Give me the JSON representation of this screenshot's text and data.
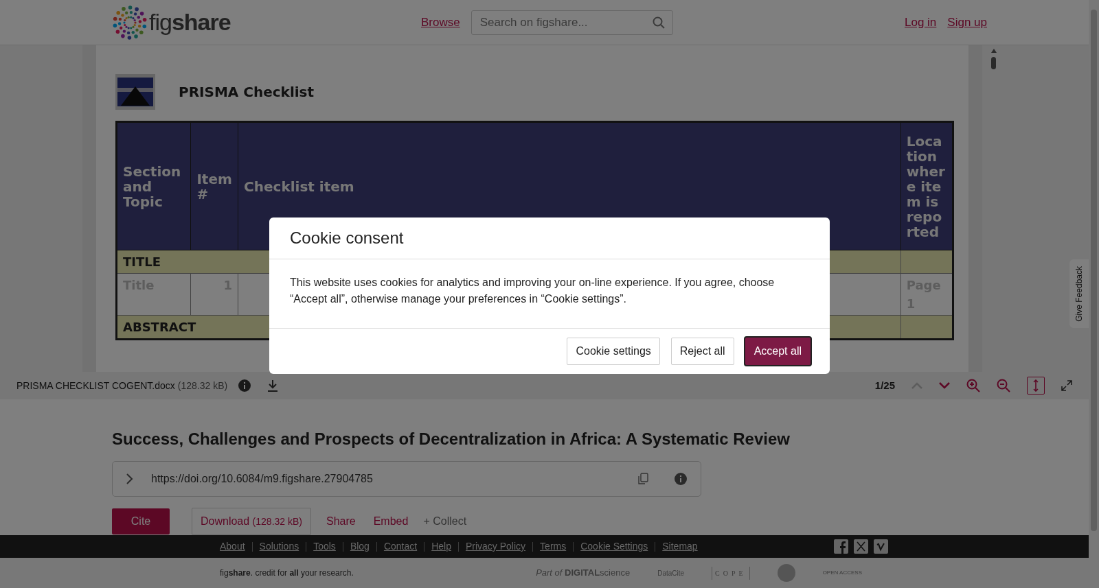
{
  "header": {
    "logo_text": "figshare",
    "nav_link": "Browse",
    "search": {
      "placeholder": "Search on figshare..."
    },
    "auth_links": [
      "Log in",
      "Sign up"
    ]
  },
  "document": {
    "title": "PRISMA Checklist",
    "columns": [
      "Section and Topic",
      "Item #",
      "Checklist item",
      "Location where item is reported"
    ],
    "rows": [
      {
        "kind": "section",
        "label": "TITLE"
      },
      {
        "kind": "item",
        "topic": "Title",
        "number": "1",
        "location": "Page 1"
      },
      {
        "kind": "section",
        "label": "ABSTRACT"
      }
    ]
  },
  "viewer_toolbar": {
    "file_name": "PRISMA CHECKLIST COGENT.docx",
    "file_size": "(128.32 kB)",
    "page": "1/25",
    "prev_disabled": true,
    "fit_selected": true
  },
  "item": {
    "title": "Success, Challenges and Prospects of Decentralization in Africa: A Systematic Review",
    "doi": "https://doi.org/10.6084/m9.figshare.27904785",
    "actions": [
      {
        "kind": "primary",
        "label": "Cite"
      },
      {
        "kind": "outline",
        "label": "Download",
        "size": "(128.32 kB)"
      },
      {
        "kind": "link",
        "label": "Share"
      },
      {
        "kind": "link",
        "label": "Embed"
      },
      {
        "kind": "muted",
        "label": "+ Collect"
      }
    ]
  },
  "footer": {
    "links": [
      "About",
      "Solutions",
      "Tools",
      "Blog",
      "Contact",
      "Help",
      "Privacy Policy",
      "Terms",
      "Cookie Settings",
      "Sitemap"
    ],
    "tagline": "fig**share**. credit for **all** your research.",
    "partners": [
      {
        "kind": "digital-science",
        "text": "*Part of* **DIGITAL**science"
      },
      {
        "kind": "datacite",
        "text": "DataCite"
      },
      {
        "kind": "cope",
        "text": "COPE"
      },
      {
        "kind": "seal"
      },
      {
        "kind": "open-access",
        "text": "OPEN ACCESS"
      }
    ]
  },
  "feedback_tab": "Give Feedback",
  "modal": {
    "title": "Cookie consent",
    "body": "This website uses cookies for analytics and improving your on-line experience. If you agree, choose “Accept all”, otherwise manage your preferences in “Cookie settings”.",
    "buttons": [
      {
        "label": "Cookie settings",
        "primary": false
      },
      {
        "label": "Reject all",
        "primary": false
      },
      {
        "label": "Accept all",
        "primary": true
      }
    ]
  }
}
